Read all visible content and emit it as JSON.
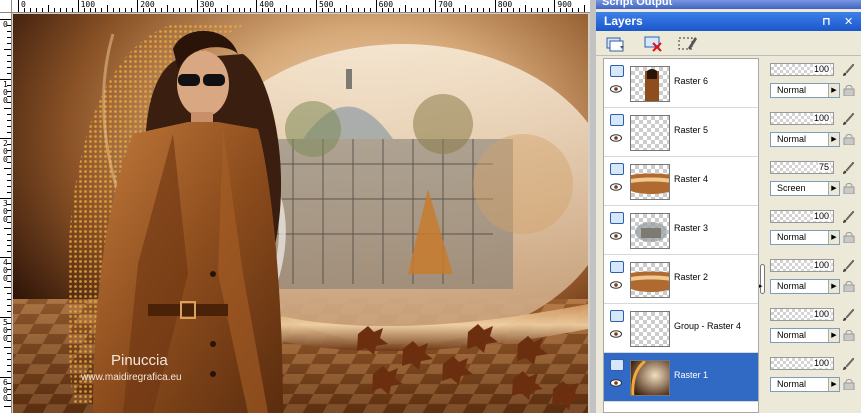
{
  "ruler": {
    "top_labels": [
      "0",
      "100",
      "200",
      "300",
      "400",
      "500",
      "600",
      "700",
      "800",
      "900"
    ],
    "left_labels": [
      "0",
      "100",
      "200",
      "300",
      "400",
      "500",
      "600"
    ]
  },
  "artwork": {
    "watermark_name": "Pinuccia",
    "watermark_url": "www.maidiregrafica.eu"
  },
  "script_output": {
    "title": "Script Output"
  },
  "layers_panel": {
    "title": "Layers",
    "pin_glyph": "❐",
    "close_glyph": "✖",
    "toolbar": [
      "new-layer-icon",
      "delete-layer-icon",
      "edit-selection-icon"
    ]
  },
  "layers": [
    {
      "name": "Raster 6",
      "opacity": "100",
      "blend": "Normal",
      "selected": false,
      "thumb": "woman"
    },
    {
      "name": "Raster 5",
      "opacity": "100",
      "blend": "Normal",
      "selected": false,
      "thumb": "empty"
    },
    {
      "name": "Raster 4",
      "opacity": "75",
      "blend": "Screen",
      "selected": false,
      "thumb": "band"
    },
    {
      "name": "Raster 3",
      "opacity": "100",
      "blend": "Normal",
      "selected": false,
      "thumb": "palace"
    },
    {
      "name": "Raster 2",
      "opacity": "100",
      "blend": "Normal",
      "selected": false,
      "thumb": "band"
    },
    {
      "name": "Group - Raster 4",
      "opacity": "100",
      "blend": "Normal",
      "selected": false,
      "thumb": "empty"
    },
    {
      "name": "Raster 1",
      "opacity": "100",
      "blend": "Normal",
      "selected": true,
      "thumb": "bg"
    }
  ],
  "colors": {
    "accent": "#316ac5",
    "title_bar": "#1a56cc",
    "artwork_brown": "#8a4f22"
  }
}
